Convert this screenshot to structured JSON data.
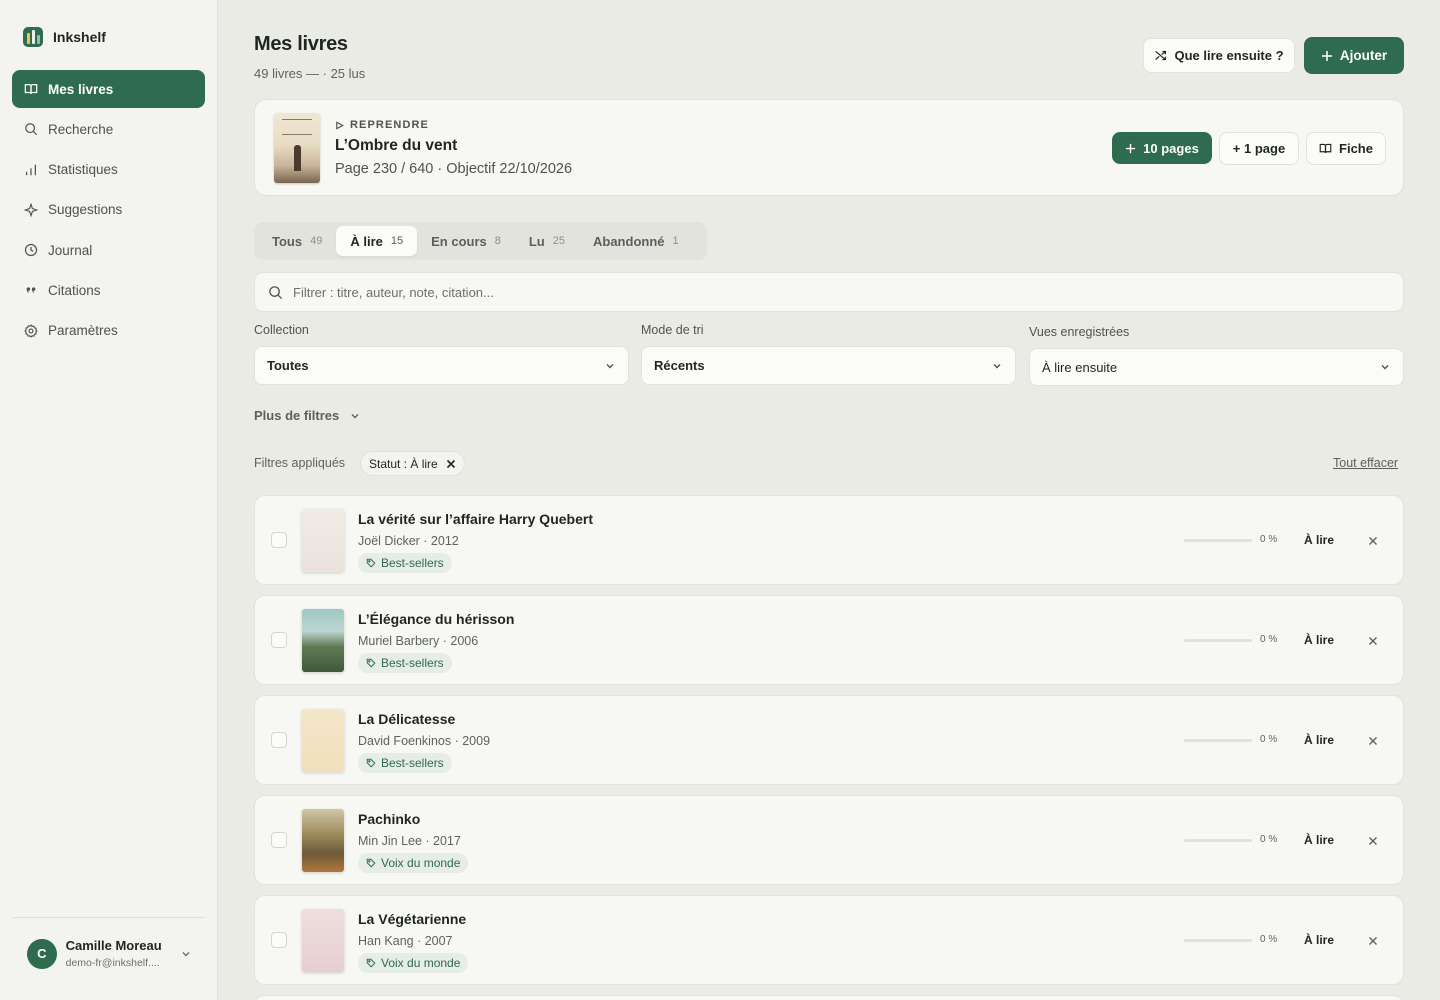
{
  "brand": {
    "name": "Inkshelf"
  },
  "nav": [
    {
      "label": "Mes livres",
      "icon": "book-open-icon",
      "active": true
    },
    {
      "label": "Recherche",
      "icon": "search-icon"
    },
    {
      "label": "Statistiques",
      "icon": "bar-chart-icon"
    },
    {
      "label": "Suggestions",
      "icon": "sparkle-icon"
    },
    {
      "label": "Journal",
      "icon": "clock-icon"
    },
    {
      "label": "Citations",
      "icon": "quote-icon"
    },
    {
      "label": "Paramètres",
      "icon": "gear-icon"
    }
  ],
  "user": {
    "initial": "C",
    "name": "Camille Moreau",
    "email": "demo-fr@inkshelf...."
  },
  "header": {
    "title": "Mes livres",
    "subtitle": "49 livres — · 25 lus",
    "suggest_label": "Que lire ensuite ?",
    "add_label": "Ajouter"
  },
  "resume": {
    "eyebrow": "REPRENDRE",
    "title": "L’Ombre du vent",
    "meta": "Page 230 / 640 · Objectif 22/10/2026",
    "progress": 0.359,
    "btn_ten": "10 pages",
    "btn_one": "+ 1 page",
    "btn_fiche": "Fiche"
  },
  "tabs": [
    {
      "label": "Tous",
      "count": "49"
    },
    {
      "label": "À lire",
      "count": "15",
      "active": true
    },
    {
      "label": "En cours",
      "count": "8"
    },
    {
      "label": "Lu",
      "count": "25"
    },
    {
      "label": "Abandonné",
      "count": "1"
    }
  ],
  "filter": {
    "placeholder": "Filtrer : titre, auteur, note, citation..."
  },
  "selects": {
    "collection": {
      "label": "Collection",
      "value": "Toutes"
    },
    "sort": {
      "label": "Mode de tri",
      "value": "Récents"
    },
    "views": {
      "label": "Vues enregistrées",
      "value": "À lire ensuite"
    }
  },
  "more_filters": "Plus de filtres",
  "applied": {
    "label": "Filtres appliqués",
    "chip": "Statut : À lire",
    "clear": "Tout effacer"
  },
  "books": [
    {
      "title": "La vérité sur l’affaire Harry Quebert",
      "author": "Joël Dicker · 2012",
      "tag": "Best-sellers",
      "progress": 0,
      "pct": "0 %",
      "status": "À lire"
    },
    {
      "title": "L’Élégance du hérisson",
      "author": "Muriel Barbery · 2006",
      "tag": "Best-sellers",
      "progress": 0,
      "pct": "0 %",
      "status": "À lire"
    },
    {
      "title": "La Délicatesse",
      "author": "David Foenkinos · 2009",
      "tag": "Best-sellers",
      "progress": 0,
      "pct": "0 %",
      "status": "À lire"
    },
    {
      "title": "Pachinko",
      "author": "Min Jin Lee · 2017",
      "tag": "Voix du monde",
      "progress": 0,
      "pct": "0 %",
      "status": "À lire"
    },
    {
      "title": "La Végétarienne",
      "author": "Han Kang · 2007",
      "tag": "Voix du monde",
      "progress": 0,
      "pct": "0 %",
      "status": "À lire"
    }
  ],
  "colors": {
    "accent": "#2f6b4f",
    "background": "#ebebe6",
    "card": "#f7f7f3"
  }
}
